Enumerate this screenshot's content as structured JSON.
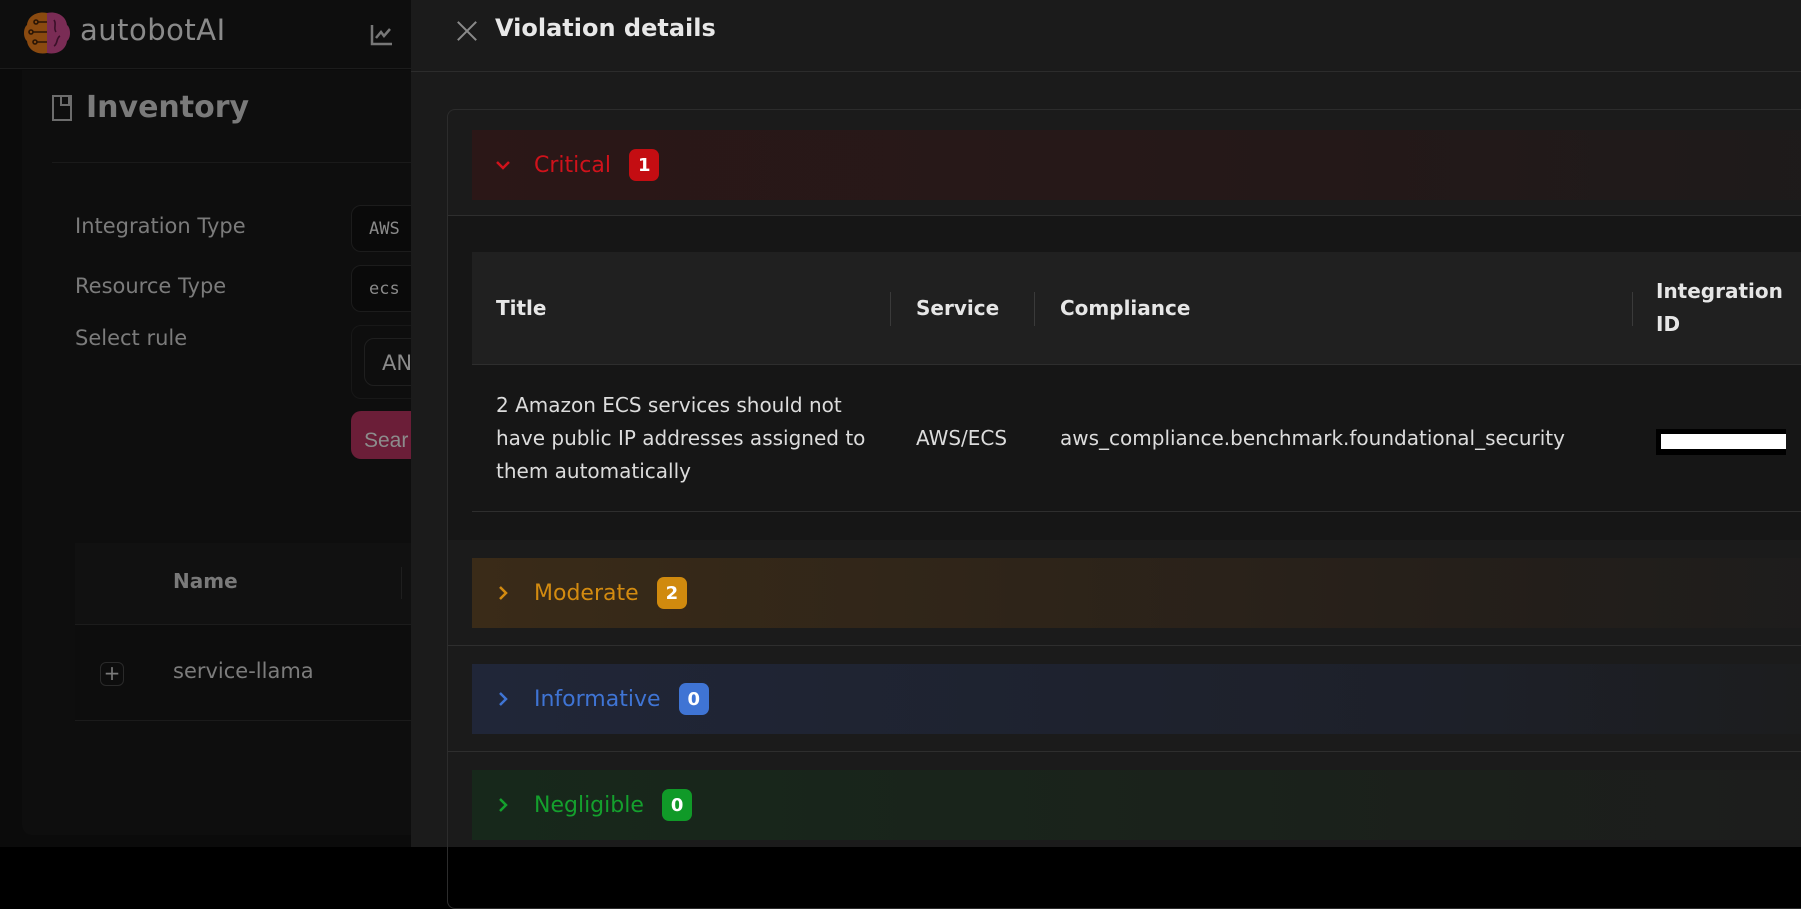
{
  "app": {
    "brand": "autobotAI",
    "logo_icon": "brain-circuit-logo",
    "nav_icon": "chart-line-icon"
  },
  "inventory": {
    "title": "Inventory",
    "title_icon": "bookmark-icon",
    "filters": {
      "integration_type": {
        "label": "Integration Type",
        "value": "AWS"
      },
      "resource_type": {
        "label": "Resource Type",
        "value": "ecs"
      },
      "select_rule": {
        "label": "Select rule",
        "value": "AN"
      }
    },
    "search_button": "Sear",
    "table": {
      "columns": [
        "Name"
      ],
      "rows": [
        {
          "name": "service-llama"
        }
      ]
    }
  },
  "drawer": {
    "title": "Violation details",
    "sections": [
      {
        "key": "critical",
        "label": "Critical",
        "count": "1",
        "expanded": true,
        "color": "#d0121b",
        "badge_color": "#c40d12"
      },
      {
        "key": "moderate",
        "label": "Moderate",
        "count": "2",
        "expanded": false,
        "color": "#d38b10",
        "badge_color": "#d08a0e"
      },
      {
        "key": "informative",
        "label": "Informative",
        "count": "0",
        "expanded": false,
        "color": "#3f74d4",
        "badge_color": "#3f74d4"
      },
      {
        "key": "negligible",
        "label": "Negligible",
        "count": "0",
        "expanded": false,
        "color": "#14a02d",
        "badge_color": "#109a28"
      }
    ],
    "violations_table": {
      "columns": [
        "Title",
        "Service",
        "Compliance",
        "Integration ID"
      ],
      "rows": [
        {
          "title": "2 Amazon ECS services should not have public IP addresses assigned to them automatically",
          "service": "AWS/ECS",
          "compliance": "aws_compliance.benchmark.foundational_security",
          "integration_id": "[redacted]"
        }
      ]
    }
  }
}
